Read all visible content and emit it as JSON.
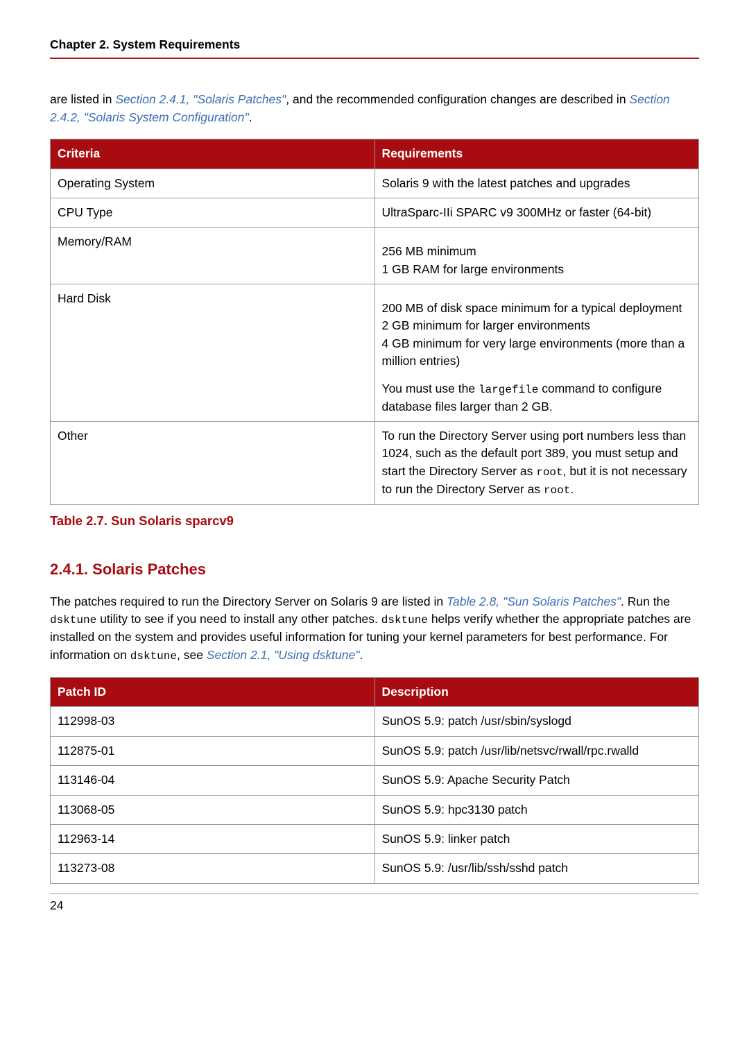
{
  "header": {
    "chapter_title": "Chapter 2. System Requirements"
  },
  "intro": {
    "pre1": "are listed in ",
    "link1": "Section 2.4.1, \"Solaris Patches\"",
    "mid1": ", and the recommended configuration changes are described in ",
    "link2": "Section 2.4.2, \"Solaris System Configuration\"",
    "post1": "."
  },
  "table1": {
    "headers": {
      "c1": "Criteria",
      "c2": "Requirements"
    },
    "rows": {
      "os": {
        "c1": "Operating System",
        "c2": "Solaris 9 with the latest patches and upgrades"
      },
      "cpu": {
        "c1": "CPU Type",
        "c2": "UltraSparc-IIi SPARC v9 300MHz or faster (64-bit)"
      },
      "mem": {
        "c1": "Memory/RAM",
        "l1": "256 MB minimum",
        "l2": "1 GB RAM for large environments"
      },
      "disk": {
        "c1": "Hard Disk",
        "l1": "200 MB of disk space minimum for a typical deployment",
        "l2": "2 GB minimum for larger environments",
        "l3": "4 GB minimum for very large environments (more than a million entries)",
        "l4a": "You must use the ",
        "l4code": "largefile",
        "l4b": " command to configure database files larger than 2 GB."
      },
      "other": {
        "c1": "Other",
        "p1a": "To run the Directory Server using port numbers less than 1024, such as the default port 389, you must setup and start the Directory Server as ",
        "p1code1": "root",
        "p1b": ", but it is not necessary to run the Directory Server as ",
        "p1code2": "root",
        "p1c": "."
      }
    },
    "caption": "Table 2.7. Sun Solaris sparcv9"
  },
  "section": {
    "heading": "2.4.1. Solaris Patches",
    "p_pre": "The patches required to run the Directory Server on Solaris 9 are listed in ",
    "p_link1": "Table 2.8, \"Sun Solaris Patches\"",
    "p_mid1": ". Run the ",
    "p_code1": "dsktune",
    "p_mid2": " utility to see if you need to install any other patches. ",
    "p_code2": "dsktune",
    "p_mid3": " helps verify whether the appropriate patches are installed on the system and provides useful information for tuning your kernel parameters for best performance. For information on ",
    "p_code3": "dsktune",
    "p_mid4": ", see ",
    "p_link2": "Section 2.1, \"Using dsktune\"",
    "p_post": "."
  },
  "table2": {
    "headers": {
      "c1": "Patch ID",
      "c2": "Description"
    },
    "rows": [
      {
        "c1": "112998-03",
        "c2": "SunOS 5.9: patch /usr/sbin/syslogd"
      },
      {
        "c1": "112875-01",
        "c2": "SunOS 5.9: patch /usr/lib/netsvc/rwall/rpc.rwalld"
      },
      {
        "c1": "113146-04",
        "c2": "SunOS 5.9: Apache Security Patch"
      },
      {
        "c1": "113068-05",
        "c2": "SunOS 5.9: hpc3130 patch"
      },
      {
        "c1": "112963-14",
        "c2": "SunOS 5.9: linker patch"
      },
      {
        "c1": "113273-08",
        "c2": "SunOS 5.9: /usr/lib/ssh/sshd patch"
      }
    ]
  },
  "footer": {
    "page_number": "24"
  }
}
